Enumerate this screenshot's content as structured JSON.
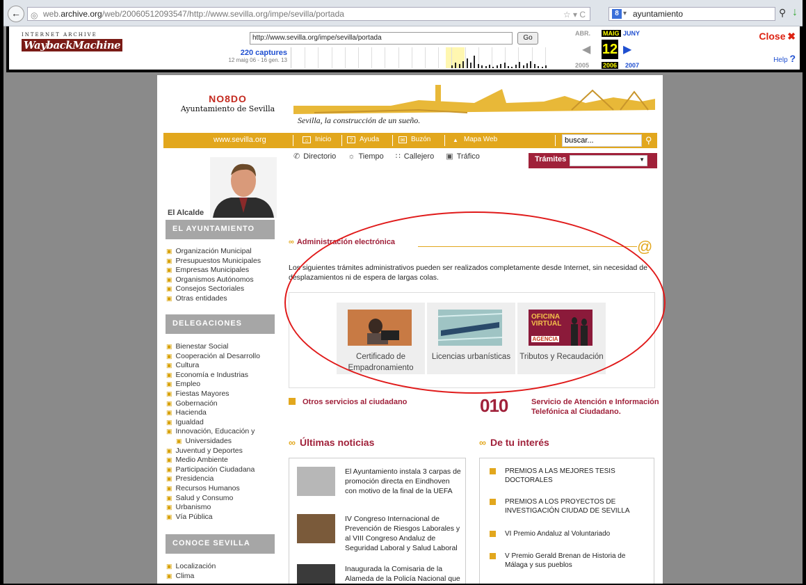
{
  "browser": {
    "url_prefix": "web.",
    "url_host": "archive.org",
    "url_rest": "/web/20060512093547/http://www.sevilla.org/impe/sevilla/portada",
    "search_value": "ayuntamiento"
  },
  "wayback": {
    "logo_top": "INTERNET ARCHIVE",
    "logo_main": "WaybackMachine",
    "url_value": "http://www.sevilla.org/impe/sevilla/portada",
    "go": "Go",
    "captures": "220 captures",
    "range": "12 maig 06 - 16 gen. 13",
    "month_prev": "ABR.",
    "month_cur": "MAIG",
    "month_next": "JUNY",
    "day": "12",
    "year_prev": "2005",
    "year_cur": "2006",
    "year_next": "2007",
    "close": "Close",
    "help": "Help"
  },
  "site": {
    "logo_no": "NO8DO",
    "logo_name": "Ayuntamiento de Sevilla",
    "slogan": "Sevilla, la construcción de un sueño.",
    "site_url": "www.sevilla.org",
    "nav": [
      "Inicio",
      "Ayuda",
      "Buzón",
      "Mapa Web"
    ],
    "search_value": "buscar...",
    "subnav": [
      "Directorio",
      "Tiempo",
      "Callejero",
      "Tráfico"
    ],
    "tramites": "Trámites",
    "alcalde": "El Alcalde",
    "ayto_title": "EL AYUNTAMIENTO",
    "ayto_items": [
      "Organización Municipal",
      "Presupuestos Municipales",
      "Empresas Municipales",
      "Organismos Autónomos",
      "Consejos Sectoriales",
      "Otras entidades"
    ],
    "deleg_title": "DELEGACIONES",
    "deleg_items": [
      "Bienestar Social",
      "Cooperación al Desarrollo",
      "Cultura",
      "Economía e Industrias",
      "Empleo",
      "Fiestas Mayores",
      "Gobernación",
      "Hacienda",
      "Igualdad",
      "Innovación, Educación y",
      "Universidades",
      "Juventud y Deportes",
      "Medio Ambiente",
      "Participación Ciudadana",
      "Presidencia",
      "Recursos Humanos",
      "Salud y Consumo",
      "Urbanismo",
      "Vía Pública"
    ],
    "conoce_title": "CONOCE SEVILLA",
    "conoce_items": [
      "Localización",
      "Clima"
    ],
    "ae_title": "Administración electrónica",
    "ae_intro": "Los siguientes trámites administrativos pueden ser realizados completamente desde Internet, sin necesidad de desplazamientos ni de espera de largas colas.",
    "tiles": [
      "Certificado de Empadronamiento",
      "Licencias urbanísticas",
      "Tributos y Recaudación"
    ],
    "tile3_sign": "OFICINA VIRTUAL",
    "tile3_sub": "AGENCIA",
    "otros": "Otros servicios al ciudadano",
    "o10": "010",
    "sac": "Servicio de Atención e Información Telefónica al Ciudadano.",
    "news_title": "Últimas noticias",
    "int_title": "De tu interés",
    "news": [
      "El Ayuntamiento instala 3 carpas de promoción directa en Eindhoven con motivo de la final de la UEFA",
      "IV Congreso Internacional de Prevención de Riesgos Laborales y al VIII Congreso Andaluz de Seguridad Laboral y Salud Laboral",
      "Inaugurada la Comisaria de la Alameda de la Policía Nacional que"
    ],
    "interest": [
      "PREMIOS A LAS MEJORES TESIS DOCTORALES",
      "PREMIOS A LOS PROYECTOS DE INVESTIGACIÓN CIUDAD DE SEVILLA",
      "VI Premio Andaluz al Voluntariado",
      "V Premio Gerald Brenan de Historia de Málaga y sus pueblos"
    ]
  }
}
